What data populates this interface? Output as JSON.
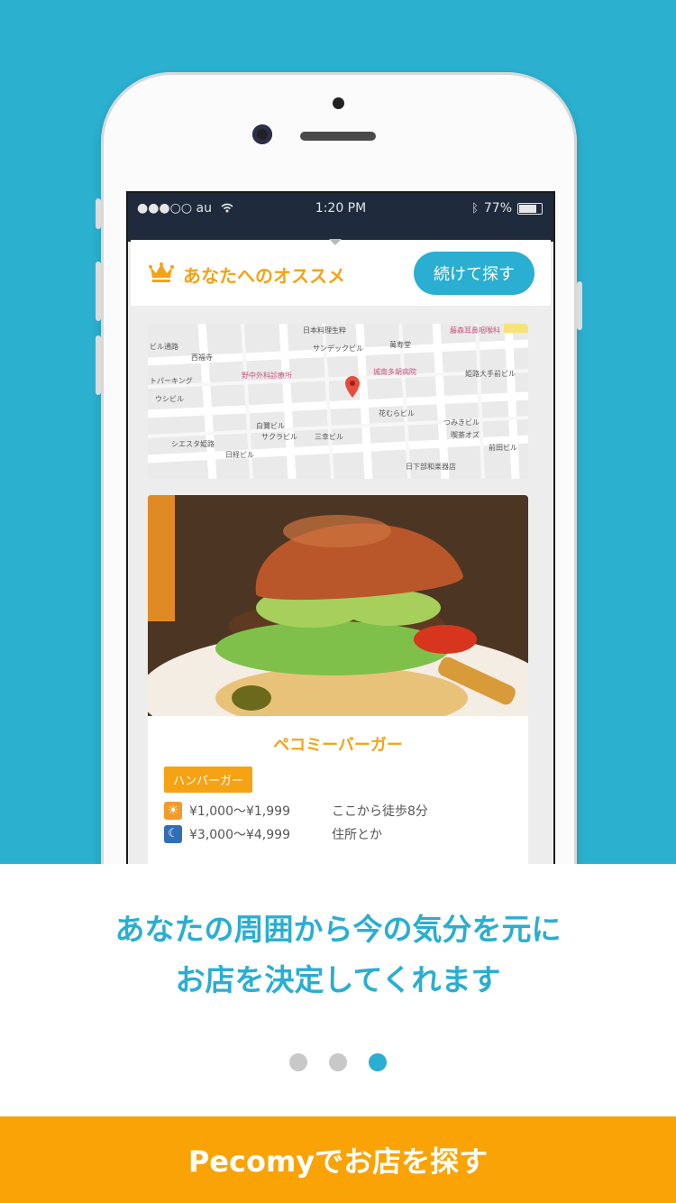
{
  "status_bar": {
    "carrier": "●●●○○ au",
    "time": "1:20 PM",
    "battery": "77%"
  },
  "recommend": {
    "title": "あなたへのオススメ",
    "continue_label": "続けて探す"
  },
  "map": {
    "labels": [
      "日本料理生粋",
      "藤森耳鼻咽喉科",
      "サンデックビル",
      "萬寿堂",
      "西福寺",
      "ビル通路",
      "野中外科診療所",
      "城南多胡病院",
      "姫路大手前ビル",
      "トパーキング",
      "ウシビル",
      "花むらビル",
      "白鷺ビル",
      "つみきビル",
      "サクラビル",
      "三幸ビル",
      "喫茶オズ",
      "シエスタ姫路",
      "日経ビル",
      "前田ビル",
      "日下部和楽器店"
    ]
  },
  "restaurant": {
    "name": "ペコミーバーガー",
    "tag": "ハンバーガー",
    "lunch_price": "¥1,000〜¥1,999",
    "dinner_price": "¥3,000〜¥4,999",
    "distance": "ここから徒歩8分",
    "address": "住所とか"
  },
  "caption": {
    "line1": "あなたの周囲から今の気分を元に",
    "line2": "お店を決定してくれます"
  },
  "pagination": {
    "total": 3,
    "active": 3
  },
  "cta_label": "Pecomyでお店を探す",
  "colors": {
    "background": "#2bb0cf",
    "accent": "#2aaed1",
    "orange": "#f5a214",
    "cta": "#f9a307"
  }
}
